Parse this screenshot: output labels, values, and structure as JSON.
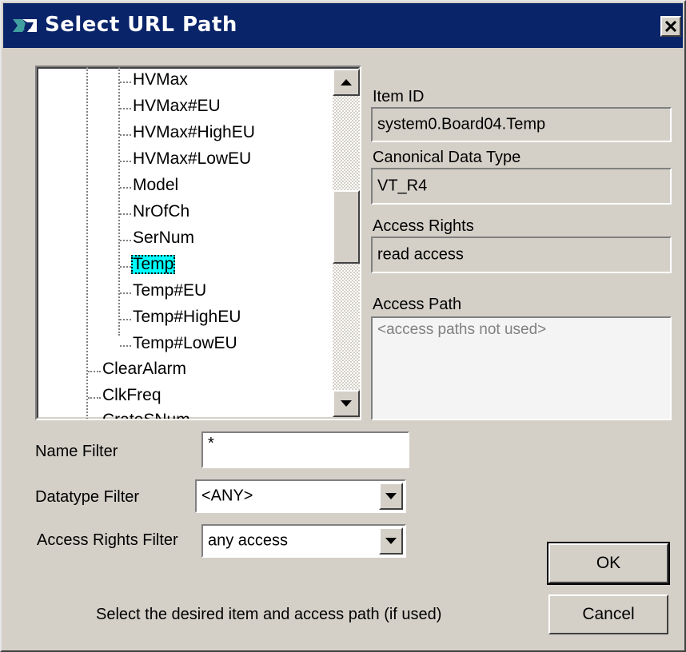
{
  "window": {
    "title": "Select URL Path",
    "close_label": "×"
  },
  "tree": {
    "items": [
      "HVMax",
      "HVMax#EU",
      "HVMax#HighEU",
      "HVMax#LowEU",
      "Model",
      "NrOfCh",
      "SerNum",
      "Temp",
      "Temp#EU",
      "Temp#HighEU",
      "Temp#LowEU"
    ],
    "selected": "Temp",
    "parent_items": [
      "ClearAlarm",
      "ClkFreq",
      "CrateSNum"
    ]
  },
  "details": {
    "item_id_label": "Item ID",
    "item_id_value": "system0.Board04.Temp",
    "datatype_label": "Canonical Data Type",
    "datatype_value": "VT_R4",
    "rights_label": "Access Rights",
    "rights_value": "read access",
    "path_label": "Access Path",
    "path_placeholder": "<access paths not used>"
  },
  "filters": {
    "name_label": "Name Filter",
    "name_value": "*",
    "datatype_label": "Datatype Filter",
    "datatype_value": "<ANY>",
    "rights_label": "Access Rights Filter",
    "rights_value": "any access"
  },
  "footer": {
    "hint": "Select the desired item and access path (if used)",
    "ok_label": "OK",
    "cancel_label": "Cancel"
  },
  "colors": {
    "title_bar": "#0a246a",
    "selection": "#00ffff",
    "face": "#d4d0c8"
  }
}
